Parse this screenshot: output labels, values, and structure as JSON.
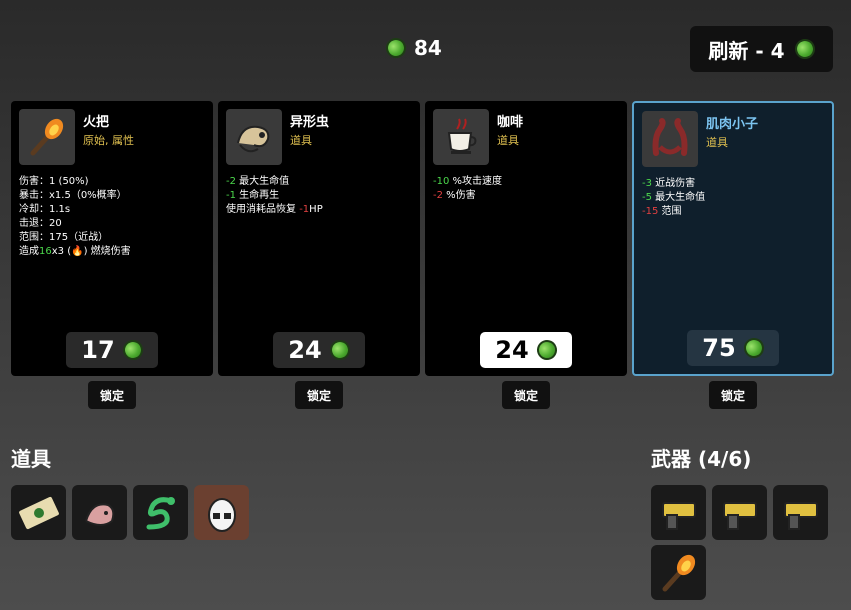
{
  "materials": {
    "count": "84"
  },
  "refresh": {
    "label": "刷新 - 4"
  },
  "cards": [
    {
      "name": "火把",
      "type": "原始, 属性",
      "stats_lines": [
        "伤害：1 (50%)",
        "暴击：x1.5（0%概率）",
        "冷却：1.1s",
        "击退：20",
        "范围：175（近战）"
      ],
      "burn_prefix": "造成",
      "burn_amount": "16",
      "burn_times": "x3",
      "burn_suffix": "燃烧伤害",
      "price": "17",
      "lock": "锁定"
    },
    {
      "name": "异形虫",
      "type": "道具",
      "line1_val": "-2",
      "line1_text": "最大生命值",
      "line2_val": "-1",
      "line2_text": "生命再生",
      "line3_text": "使用消耗品恢复",
      "line3_val": "-1",
      "line3_unit": "HP",
      "price": "24",
      "lock": "锁定"
    },
    {
      "name": "咖啡",
      "type": "道具",
      "line1_val": "-10",
      "line1_text": "%攻击速度",
      "line2_val": "-2",
      "line2_text": "%伤害",
      "price": "24",
      "lock": "锁定"
    },
    {
      "name": "肌肉小子",
      "type": "道具",
      "line1_val": "-3",
      "line1_text": "近战伤害",
      "line2_val": "-5",
      "line2_text": "最大生命值",
      "line3_val": "-15",
      "line3_text": "范围",
      "price": "75",
      "lock": "锁定"
    }
  ],
  "items_section": {
    "title": "道具"
  },
  "weapons_section": {
    "title": "武器 (4/6)"
  },
  "colors": {
    "positive": "#4cd84c",
    "negative": "#e04040",
    "selected_border": "#5aa3cc"
  }
}
